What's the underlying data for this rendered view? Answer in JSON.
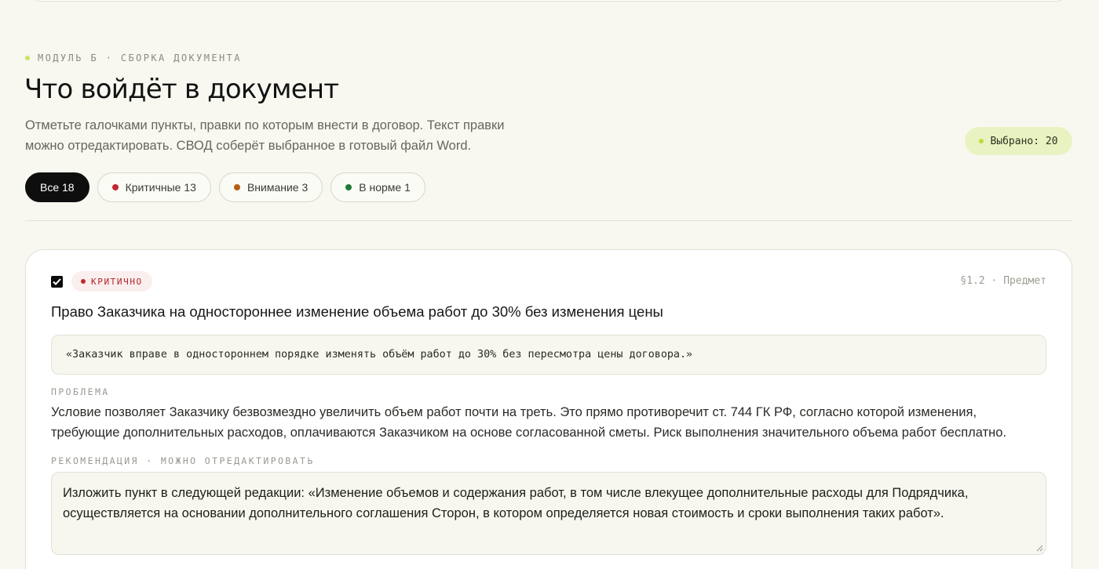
{
  "header": {
    "eyebrow": "МОДУЛЬ Б · СБОРКА ДОКУМЕНТА",
    "title": "Что войдёт в документ",
    "subtitle": "Отметьте галочками пункты, правки по которым внести в договор. Текст правки можно отредактировать. СВОД соберёт выбранное в готовый файл Word.",
    "selected_label": "Выбрано: 20"
  },
  "filters": [
    {
      "label": "Все 18",
      "active": true,
      "dot_color": null
    },
    {
      "label": "Критичные 13",
      "active": false,
      "dot_color": "#c0282e"
    },
    {
      "label": "Внимание 3",
      "active": false,
      "dot_color": "#b45f14"
    },
    {
      "label": "В норме 1",
      "active": false,
      "dot_color": "#1f7a3a"
    }
  ],
  "issue": {
    "checked": true,
    "severity": "КРИТИЧНО",
    "severity_color": "#c0282e",
    "clause": "§1.2 · Предмет",
    "title": "Право Заказчика на одностороннее изменение объема работ до 30% без изменения цены",
    "quote": "«Заказчик вправе в одностороннем порядке изменять объём работ до 30% без пересмотра цены договора.»",
    "problem_label": "ПРОБЛЕМА",
    "problem_text": "Условие позволяет Заказчику безвозмездно увеличить объем работ почти на треть. Это прямо противоречит ст. 744 ГК РФ, согласно которой изменения, требующие дополнительных расходов, оплачиваются Заказчиком на основе согласованной сметы. Риск выполнения значительного объема работ бесплатно.",
    "recommendation_label": "РЕКОМЕНДАЦИЯ · МОЖНО ОТРЕДАКТИРОВАТЬ",
    "recommendation_text": "Изложить пункт в следующей редакции: «Изменение объемов и содержания работ, в том числе влекущее дополнительные расходы для Подрядчика, осуществляется на основании дополнительного соглашения Сторон, в котором определяется новая стоимость и сроки выполнения таких работ»."
  },
  "colors": {
    "accent_lime": "#c8e65a",
    "background": "#f8f8f1",
    "critical": "#c0282e"
  }
}
